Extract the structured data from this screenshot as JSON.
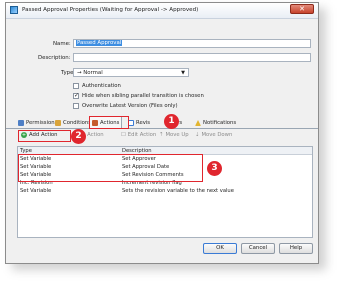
{
  "window": {
    "title": "Passed Approval Properties (Waiting for Approval -> Approved)",
    "close_glyph": "✕"
  },
  "form": {
    "name_label": "Name:",
    "name_value": "Passed Approval",
    "description_label": "Description:",
    "description_value": "",
    "type_label": "Type:",
    "type_value": "→ Normal",
    "checkboxes": [
      {
        "label": "Authentication",
        "checked": false
      },
      {
        "label": "Hide when sibling parallel transition is chosen",
        "checked": true
      },
      {
        "label": "Overwrite Latest Version (Files only)",
        "checked": false
      }
    ]
  },
  "tabs": [
    {
      "label": "Permissions",
      "icon": "permissions-icon"
    },
    {
      "label": "Conditions",
      "icon": "conditions-icon"
    },
    {
      "label": "Actions",
      "icon": "actions-icon",
      "active": true
    },
    {
      "label": "Revis",
      "icon": "revision-icon"
    },
    {
      "label": "ers",
      "icon": "watchers-icon"
    },
    {
      "label": "Notifications",
      "icon": "notifications-icon"
    }
  ],
  "toolbar": {
    "add_action": "Add Action",
    "remove_action": "ve Action",
    "edit_action": "Edit Action",
    "move_up": "Move Up",
    "move_down": "Move Down"
  },
  "grid": {
    "columns": [
      "Type",
      "Description"
    ],
    "rows": [
      {
        "type": "Set Variable",
        "description": "Set Approver"
      },
      {
        "type": "Set Variable",
        "description": "Set Approval Date"
      },
      {
        "type": "Set Variable",
        "description": "Set Revision Comments"
      },
      {
        "type": "Inc. Revision",
        "description": "Increment revision flag"
      },
      {
        "type": "Set Variable",
        "description": "Sets the revision variable to the next value"
      }
    ]
  },
  "buttons": {
    "ok": "OK",
    "cancel": "Cancel",
    "help": "Help"
  },
  "callouts": [
    "1",
    "2",
    "3"
  ],
  "colors": {
    "callout": "#e0262e",
    "selection": "#3d8ee2"
  }
}
